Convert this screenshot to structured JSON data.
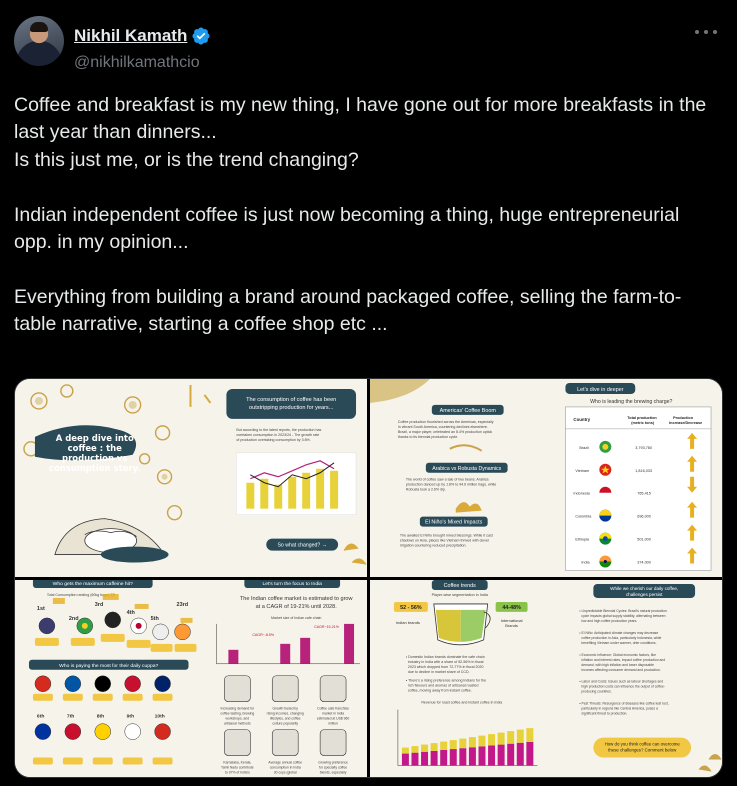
{
  "author": {
    "display_name": "Nikhil Kamath",
    "handle": "@nikhilkamathcio",
    "verified_color": "#1d9bf0"
  },
  "tweet": {
    "paragraphs": [
      "Coffee and breakfast is my new thing, I have gone out for more breakfasts in the last year than dinners...\nIs this just me, or is the trend changing?",
      "Indian independent coffee is just now becoming a thing, huge entrepreneurial opp. in my opinion...",
      "Everything from building a brand around packaged coffee, selling the farm-to-table narrative, starting a coffee shop etc ..."
    ]
  },
  "media": {
    "panel1": {
      "title": "A deep dive into coffee : the production vs consumption story.",
      "callout": "The consumption of coffee has been outstripping production for years...",
      "button": "So what changed? →"
    },
    "panel2": {
      "header": "Let's dive in deeper",
      "question": "Who is leading the brewing charge?",
      "sub1": "Americas' Coffee Boom",
      "sub2": "Arabica vs Robusta Dynamics",
      "sub3": "El Niño's Mixed Impacts",
      "col_country": "Country",
      "col_total": "Total production (metric tons)",
      "col_change": "Production Increase/Decrease",
      "rows": [
        {
          "country": "Brazil",
          "total": "3,793,780"
        },
        {
          "country": "Vietnam",
          "total": "1,816,033"
        },
        {
          "country": "Indonesia",
          "total": "765,415"
        },
        {
          "country": "Colombia",
          "total": "696,000"
        },
        {
          "country": "Ethiopia",
          "total": "501,000"
        },
        {
          "country": "India",
          "total": "374,000"
        }
      ]
    },
    "panel3": {
      "q1": "Who gets the maximum caffeine hit?",
      "q2": "Who is paying the most for their daily cuppa?",
      "q3": "Let's turn the focus to India",
      "callout": "The Indian coffee market is estimated to grow at a CAGR of 19-21% until 2028.",
      "ranks": [
        "1st",
        "2nd",
        "3rd",
        "4th",
        "5th",
        "23rd"
      ]
    },
    "panel4": {
      "title": "Coffee trends",
      "segment": "Player-wise segmentation in India",
      "left_pct": "52 - 56%",
      "left_label": "Indian brands",
      "right_pct": "44-48%",
      "right_label": "International Brands",
      "challenge": "While we cherish our daily coffee, challenges persist",
      "cta": "How do you think coffee can overcome these challenges? Comment below"
    }
  }
}
